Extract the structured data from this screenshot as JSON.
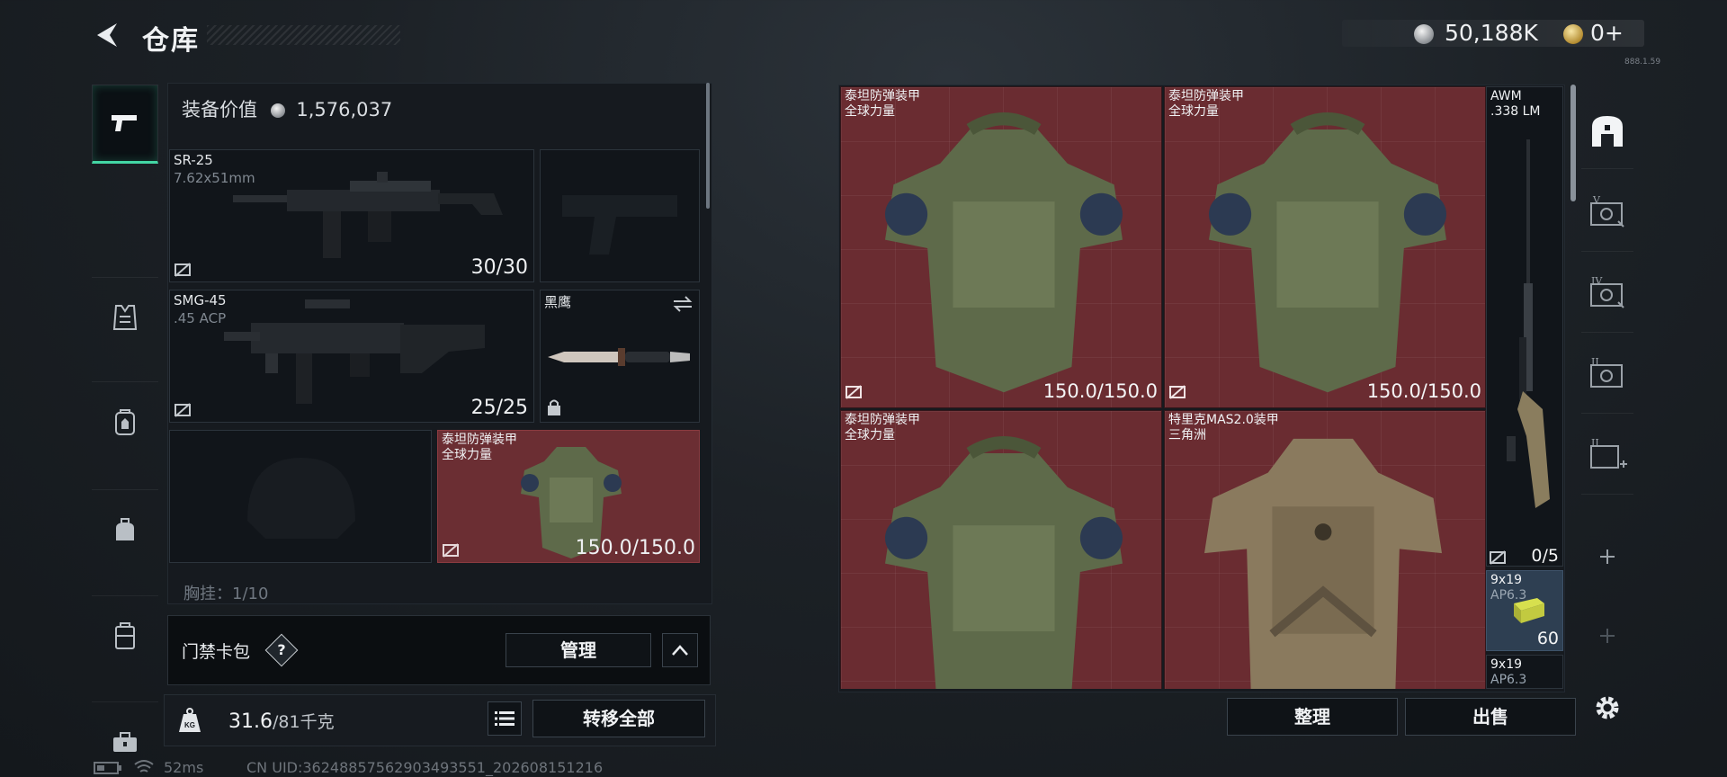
{
  "header": {
    "title": "仓库",
    "silver_amount": "50,188K",
    "gold_amount": "0+",
    "tiny_label": "888.1.59"
  },
  "loadout": {
    "value_label": "装备价值",
    "value_amount": "1,576,037",
    "primary": {
      "name": "SR-25",
      "caliber": "7.62x51mm",
      "ammo": "30/30"
    },
    "secondary": {
      "name": "SMG-45",
      "caliber": ".45 ACP",
      "ammo": "25/25"
    },
    "melee": {
      "name": "黑鹰"
    },
    "armor": {
      "name": "泰坦防弹装甲",
      "sub": "全球力量",
      "durability": "150.0/150.0"
    },
    "partial_row": "胸挂：1/10"
  },
  "card_pack": {
    "label": "门禁卡包",
    "help": "?",
    "manage_label": "管理"
  },
  "weight": {
    "current": "31.6",
    "max": "/81千克",
    "transfer_label": "转移全部"
  },
  "status": {
    "ping": "52ms",
    "uid": "CN UID:36248857562903493551_202608151216"
  },
  "storage": {
    "items": [
      {
        "name": "泰坦防弹装甲",
        "sub": "全球力量",
        "durability": "150.0/150.0"
      },
      {
        "name": "泰坦防弹装甲",
        "sub": "全球力量",
        "durability": "150.0/150.0"
      },
      {
        "name": "泰坦防弹装甲",
        "sub": "全球力量"
      },
      {
        "name": "特里克MAS2.0装甲",
        "sub": "三角洲"
      }
    ],
    "awm": {
      "name": "AWM",
      "caliber": ".338 LM",
      "count": "0/5"
    },
    "ammo1": {
      "name": "9x19",
      "sub": "AP6.3",
      "count": "60"
    },
    "ammo2": {
      "name": "9x19",
      "sub": "AP6.3"
    },
    "sort_label": "整理",
    "sell_label": "出售"
  },
  "right_rail": {
    "slot_labels": [
      "V",
      "IV",
      "II",
      "II"
    ]
  },
  "colors": {
    "accent": "#43d6a4",
    "item_red": "#6a2c31",
    "ammo_blue": "#2e3f52"
  }
}
